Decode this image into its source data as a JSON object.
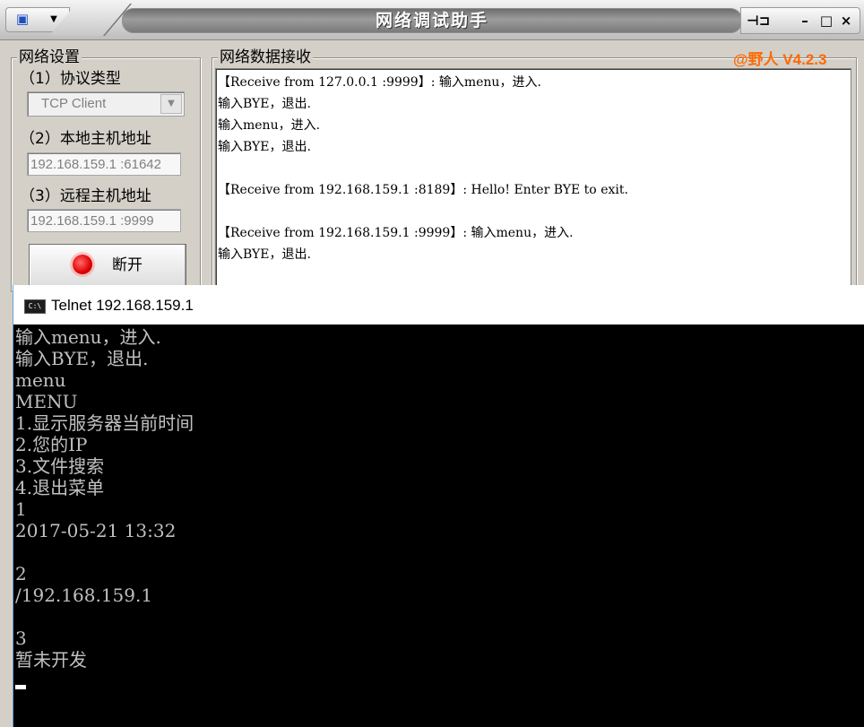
{
  "app": {
    "title": "网络调试助手",
    "version": "@野人 V4.2.3",
    "controls": {
      "pin": "⊣⊐",
      "minimize": "–",
      "maximize": "□",
      "close": "×"
    }
  },
  "settings": {
    "group_label": "网络设置",
    "protocol_label": "（1）协议类型",
    "protocol_value": "TCP Client",
    "local_label": "（2）本地主机地址",
    "local_value": "192.168.159.1 :61642",
    "remote_label": "（3）远程主机地址",
    "remote_value": "192.168.159.1 :9999",
    "connect_button": "断开"
  },
  "receive": {
    "group_label": "网络数据接收",
    "lines": [
      "【Receive from 127.0.0.1 :9999】: 输入menu，进入.",
      "输入BYE，退出.",
      "输入menu，进入.",
      "输入BYE，退出.",
      "",
      "【Receive from 192.168.159.1 :8189】: Hello! Enter BYE to exit.",
      "",
      "【Receive from 192.168.159.1 :9999】: 输入menu，进入.",
      "输入BYE，退出."
    ]
  },
  "telnet": {
    "title": "Telnet 192.168.159.1",
    "icon_text": "C:\\",
    "lines": [
      "输入menu，进入.",
      "输入BYE，退出.",
      "menu",
      "MENU",
      "1.显示服务器当前时间",
      "2.您的IP",
      "3.文件搜索",
      "4.退出菜单",
      "1",
      "2017-05-21 13:32",
      "",
      "2",
      "/192.168.159.1",
      "",
      "3",
      "暂未开发"
    ]
  }
}
